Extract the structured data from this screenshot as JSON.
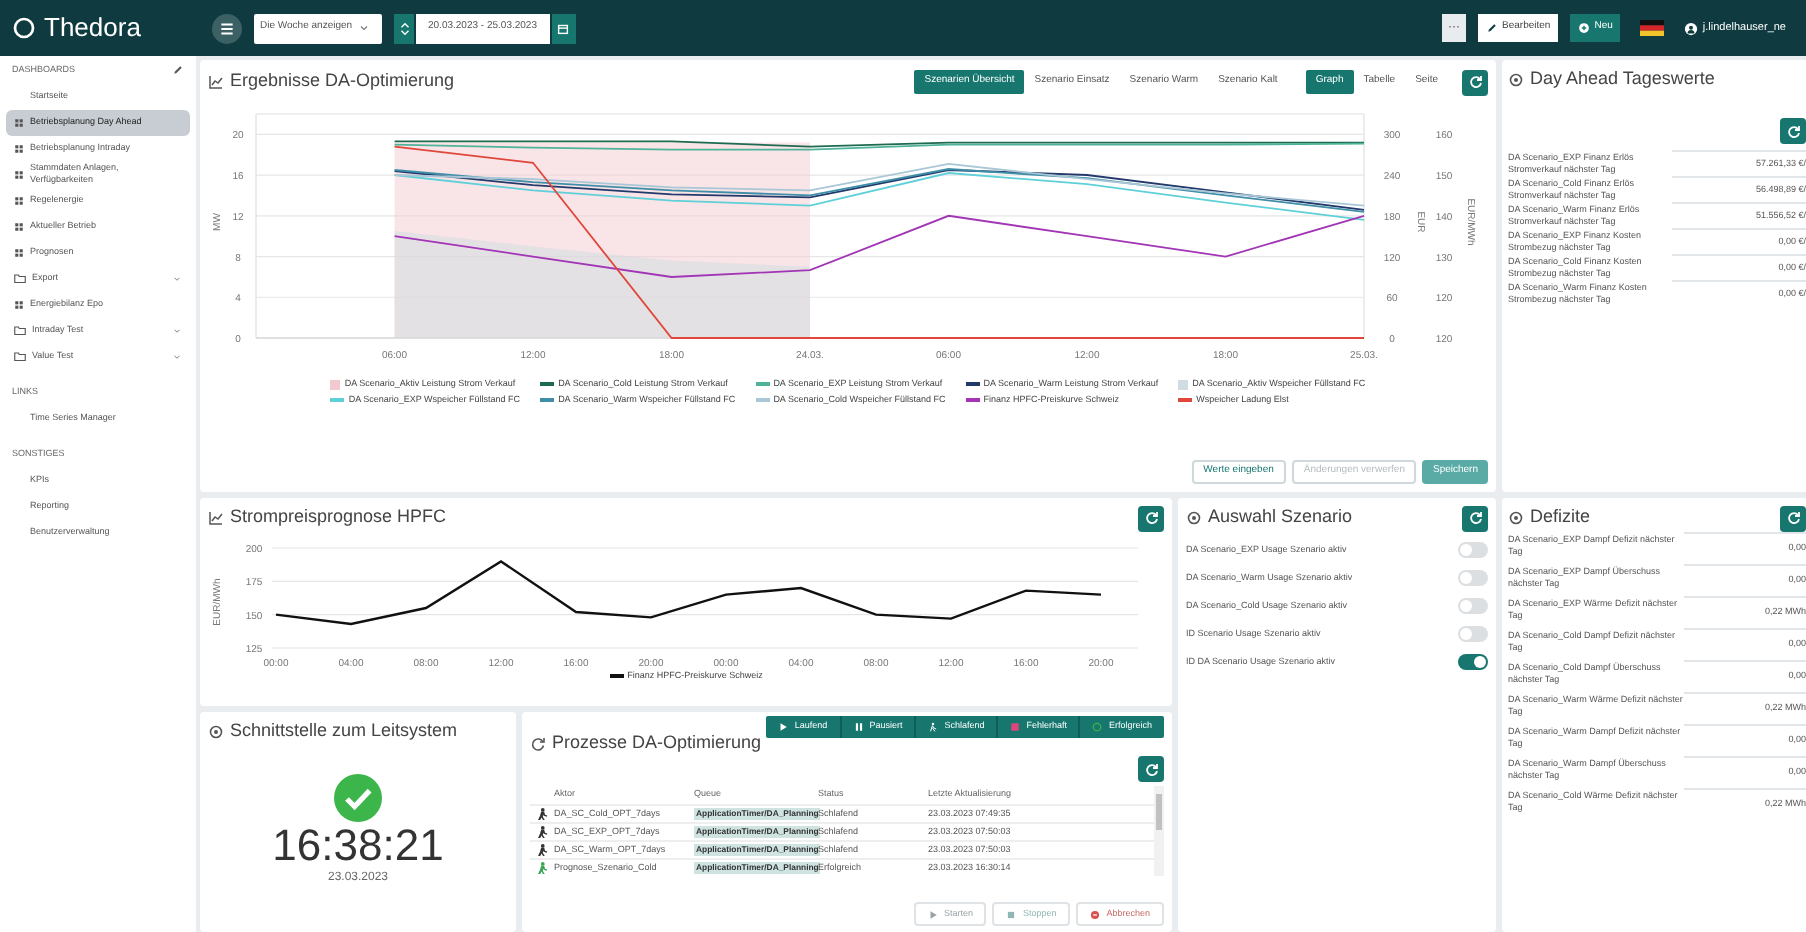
{
  "topbar": {
    "logo": "Thedora",
    "period_select": "Die Woche anzeigen",
    "date_range": "20.03.2023 - 25.03.2023",
    "more_button": "···",
    "edit_button": "Bearbeiten",
    "new_button": "Neu",
    "user": "j.lindelhauser_ne"
  },
  "sidebar": {
    "sections": [
      {
        "title": "DASHBOARDS",
        "items": [
          {
            "label": "Startseite",
            "kind": "plain",
            "selected": false
          },
          {
            "label": "Betriebsplanung Day Ahead",
            "kind": "dashboard",
            "selected": true
          },
          {
            "label": "Betriebsplanung Intraday",
            "kind": "dashboard",
            "selected": false
          },
          {
            "label": "Stammdaten Anlagen, Verfügbarkeiten",
            "kind": "dashboard",
            "selected": false
          },
          {
            "label": "Regelenergie",
            "kind": "dashboard",
            "selected": false
          },
          {
            "label": "Aktueller Betrieb",
            "kind": "dashboard",
            "selected": false
          },
          {
            "label": "Prognosen",
            "kind": "dashboard",
            "selected": false
          },
          {
            "label": "Export",
            "kind": "folder",
            "selected": false
          },
          {
            "label": "Energiebilanz Epo",
            "kind": "dashboard",
            "selected": false
          },
          {
            "label": "Intraday Test",
            "kind": "folder",
            "selected": false
          },
          {
            "label": "Value Test",
            "kind": "folder",
            "selected": false
          }
        ]
      },
      {
        "title": "LINKS",
        "items": [
          {
            "label": "Time Series Manager",
            "kind": "plain",
            "selected": false
          }
        ]
      },
      {
        "title": "SONSTIGES",
        "items": [
          {
            "label": "KPIs",
            "kind": "plain",
            "selected": false
          },
          {
            "label": "Reporting",
            "kind": "plain",
            "selected": false
          },
          {
            "label": "Benutzerverwaltung",
            "kind": "plain",
            "selected": false
          }
        ]
      }
    ]
  },
  "results_panel": {
    "title": "Ergebnisse DA-Optimierung",
    "scenario_tabs": [
      {
        "label": "Szenarien Übersicht",
        "selected": true
      },
      {
        "label": "Szenario Einsatz",
        "selected": false
      },
      {
        "label": "Szenario Warm",
        "selected": false
      },
      {
        "label": "Szenario Kalt",
        "selected": false
      }
    ],
    "view_tabs": [
      {
        "label": "Graph",
        "selected": true
      },
      {
        "label": "Tabelle",
        "selected": false
      },
      {
        "label": "Seite",
        "selected": false
      }
    ],
    "chart_data": {
      "type": "line",
      "ylabel": "MW",
      "yticks": [
        20,
        16,
        12,
        8,
        4,
        0
      ],
      "ylim": [
        0,
        22
      ],
      "y2label": "EUR",
      "y2ticks": [
        300,
        240,
        180,
        120,
        60,
        0
      ],
      "y2lim": [
        0,
        330
      ],
      "grid": true,
      "categories": [
        "06:00",
        "12:00",
        "18:00",
        "24.03.",
        "06:00",
        "12:00",
        "18:00",
        "25.03."
      ],
      "series": [
        {
          "name": "DA Scenario_Aktiv Leistung Strom Verkauf",
          "color": "#f3c9d0",
          "type": "area",
          "values": [
            19.2,
            19.2,
            19.2,
            19.2,
            null,
            null,
            null,
            null
          ]
        },
        {
          "name": "DA Scenario_Cold Leistung Strom Verkauf",
          "color": "#1d6b4f",
          "type": "line",
          "values": [
            19.3,
            19.3,
            19.3,
            18.8,
            19.2,
            19.2,
            19.2,
            19.2
          ]
        },
        {
          "name": "DA Scenario_EXP Leistung Strom Verkauf",
          "color": "#4fb39a",
          "type": "line",
          "values": [
            19,
            18.7,
            18.5,
            18.5,
            19,
            19,
            19,
            19.1
          ]
        },
        {
          "name": "DA Scenario_Warm Leistung Strom Verkauf",
          "color": "#223a6b",
          "type": "line",
          "values": [
            16.4,
            15,
            14.1,
            13.8,
            16.5,
            16,
            14.3,
            12.6
          ]
        },
        {
          "name": "DA Scenario_Aktiv Wspeicher Füllstand FC",
          "color": "#cfdde2",
          "type": "area",
          "values": [
            10.5,
            9,
            7.6,
            7,
            null,
            null,
            null,
            null
          ]
        },
        {
          "name": "DA Scenario_EXP Wspeicher Füllstand FC",
          "color": "#5fd0d8",
          "type": "line",
          "values": [
            16,
            14.5,
            13.5,
            13,
            16.2,
            15.1,
            13.3,
            11.6
          ]
        },
        {
          "name": "DA Scenario_Warm Wspeicher Füllstand FC",
          "color": "#3f8ea8",
          "type": "line",
          "values": [
            16.5,
            15.3,
            14.5,
            14,
            16.6,
            15.7,
            14,
            12.4
          ]
        },
        {
          "name": "DA Scenario_Cold Wspeicher Füllstand FC",
          "color": "#a9c7d6",
          "type": "line",
          "values": [
            16,
            15.6,
            14.8,
            14.5,
            17.1,
            15.6,
            14.2,
            13
          ]
        },
        {
          "name": "Finanz HPFC-Preiskurve Schweiz",
          "color": "#a235b5",
          "type": "line",
          "axis": "y2",
          "values": [
            150,
            120,
            90,
            100,
            180,
            150,
            120,
            180
          ]
        },
        {
          "name": "Wspeicher Ladung Elst",
          "color": "#e0473a",
          "type": "line",
          "values": [
            18.8,
            17.2,
            0,
            0,
            0,
            0,
            0,
            0
          ]
        }
      ]
    },
    "y_right2_label": "EUR/MWh",
    "y_right2_ticks": [
      "160",
      "150",
      "140",
      "130",
      "120",
      "120"
    ],
    "buttons": [
      {
        "label": "Werte eingeben",
        "kind": "outline",
        "disabled": false
      },
      {
        "label": "Änderungen verwerfen",
        "kind": "outline",
        "disabled": true
      },
      {
        "label": "Speichern",
        "kind": "primary",
        "disabled": true
      }
    ]
  },
  "day_ahead_panel": {
    "title": "Day Ahead Tageswerte",
    "rows": [
      {
        "label": "DA Scenario_EXP Finanz Erlös Stromverkauf nächster Tag",
        "value": "57.261,33 €/"
      },
      {
        "label": "DA Scenario_Cold Finanz Erlös Stromverkauf nächster Tag",
        "value": "56.498,89 €/"
      },
      {
        "label": "DA Scenario_Warm Finanz Erlös Stromverkauf nächster Tag",
        "value": "51.556,52 €/"
      },
      {
        "label": "DA Scenario_EXP Finanz Kosten Strombezug nächster Tag",
        "value": "0,00 €/"
      },
      {
        "label": "DA Scenario_Cold Finanz Kosten Strombezug nächster Tag",
        "value": "0,00 €/"
      },
      {
        "label": "DA Scenario_Warm Finanz Kosten Strombezug nächster Tag",
        "value": "0,00 €/"
      }
    ]
  },
  "price_panel": {
    "title": "Strompreisprognose HPFC",
    "chart_data": {
      "type": "line",
      "ylabel": "EUR/MWh",
      "yticks": [
        200,
        175,
        150,
        125
      ],
      "ylim": [
        125,
        200
      ],
      "grid": true,
      "categories": [
        "00:00",
        "04:00",
        "08:00",
        "12:00",
        "16:00",
        "20:00",
        "00:00",
        "04:00",
        "08:00",
        "12:00",
        "16:00",
        "20:00"
      ],
      "series": [
        {
          "name": "Finanz HPFC-Preiskurve Schweiz",
          "color": "#111111",
          "values": [
            150,
            143,
            155,
            190,
            152,
            148,
            165,
            170,
            150,
            147,
            168,
            165
          ]
        }
      ]
    }
  },
  "scenario_panel": {
    "title": "Auswahl Szenario",
    "toggles": [
      {
        "label": "DA Scenario_EXP Usage Szenario aktiv",
        "on": false
      },
      {
        "label": "DA Scenario_Warm Usage Szenario aktiv",
        "on": false
      },
      {
        "label": "DA Scenario_Cold Usage Szenario aktiv",
        "on": false
      },
      {
        "label": "ID Scenario Usage Szenario aktiv",
        "on": false
      },
      {
        "label": "ID DA Scenario Usage Szenario aktiv",
        "on": true
      }
    ]
  },
  "deficit_panel": {
    "title": "Defizite",
    "rows": [
      {
        "label": "DA Scenario_EXP Dampf Defizit nächster Tag",
        "value": "0,00"
      },
      {
        "label": "DA Scenario_EXP Dampf Überschuss nächster Tag",
        "value": "0,00"
      },
      {
        "label": "DA Scenario_EXP Wärme Defizit nächster Tag",
        "value": "0,22 MWh"
      },
      {
        "label": "DA Scenario_Cold Dampf Defizit nächster Tag",
        "value": "0,00"
      },
      {
        "label": "DA Scenario_Cold Dampf Überschuss nächster Tag",
        "value": "0,00"
      },
      {
        "label": "DA Scenario_Warm Wärme Defizit nächster Tag",
        "value": "0,22 MWh"
      },
      {
        "label": "DA Scenario_Warm Dampf Defizit nächster Tag",
        "value": "0,00"
      },
      {
        "label": "DA Scenario_Warm Dampf Überschuss nächster Tag",
        "value": "0,00"
      },
      {
        "label": "DA Scenario_Cold Wärme Defizit nächster Tag",
        "value": "0,22 MWh"
      }
    ]
  },
  "interface_panel": {
    "title": "Schnittstelle zum Leitsystem",
    "ok": true,
    "time": "16:38:21",
    "date": "23.03.2023"
  },
  "process_panel": {
    "title": "Prozesse DA-Optimierung",
    "filters": [
      {
        "label": "Laufend",
        "kind": "play"
      },
      {
        "label": "Pausiert",
        "kind": "pause"
      },
      {
        "label": "Schlafend",
        "kind": "sleep"
      },
      {
        "label": "Fehlerhaft",
        "kind": "error"
      },
      {
        "label": "Erfolgreich",
        "kind": "success"
      }
    ],
    "columns": [
      "Aktor",
      "Queue",
      "Status",
      "Letzte Aktualisierung"
    ],
    "rows": [
      {
        "color": "#333333",
        "cells": [
          "DA_SC_Cold_OPT_7days",
          "ApplicationTimer/DA_Planning",
          "Schlafend",
          "23.03.2023 07:49:35"
        ]
      },
      {
        "color": "#333333",
        "cells": [
          "DA_SC_EXP_OPT_7days",
          "ApplicationTimer/DA_Planning",
          "Schlafend",
          "23.03.2023 07:50:03"
        ]
      },
      {
        "color": "#333333",
        "cells": [
          "DA_SC_Warm_OPT_7days",
          "ApplicationTimer/DA_Planning",
          "Schlafend",
          "23.03.2023 07:50:03"
        ]
      },
      {
        "color": "#3aa655",
        "cells": [
          "Prognose_Szenario_Cold",
          "ApplicationTimer/DA_Planning",
          "Erfolgreich",
          "23.03.2023 16:30:14"
        ]
      }
    ],
    "buttons": [
      {
        "label": "Starten",
        "kind": "start"
      },
      {
        "label": "Stoppen",
        "kind": "stop"
      },
      {
        "label": "Abbrechen",
        "kind": "cancel"
      }
    ]
  }
}
